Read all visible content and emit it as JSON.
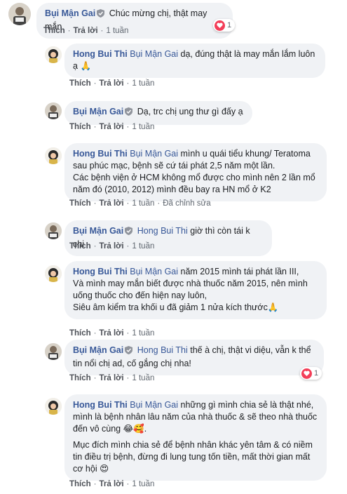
{
  "comments": [
    {
      "author": "Bụi Mận Gai",
      "text": "Chúc mừng chị, thật may mắn",
      "actions": {
        "like": "Thích",
        "reply": "Trả lời",
        "time": "1 tuần"
      },
      "reaction_count": "1"
    },
    {
      "author": "Hong Bui Thi",
      "mention": "Bụi Mận Gai",
      "text": "dạ, đúng thật là may mắn lắm luôn ạ",
      "actions": {
        "like": "Thích",
        "reply": "Trả lời",
        "time": "1 tuần"
      }
    },
    {
      "author": "Bụi Mận Gai",
      "text": "Dạ, trc chị ung thư gì đấy ạ",
      "actions": {
        "like": "Thích",
        "reply": "Trả lời",
        "time": "1 tuần"
      }
    },
    {
      "author": "Hong Bui Thi",
      "mention": "Bụi Mận Gai",
      "line1": "mình u quái tiểu khung/ Teratoma sau phúc mạc, bệnh sẽ cứ tái phát 2,5 năm một lần.",
      "line2": "Các bệnh viện ở HCM không mổ được cho mình nên 2 lần mổ năm đó (2010, 2012) mình đều bay ra HN mổ ở K2",
      "actions": {
        "like": "Thích",
        "reply": "Trả lời",
        "time": "1 tuần",
        "edited": "Đã chỉnh sửa"
      }
    },
    {
      "author": "Bụi Mận Gai",
      "mention": "Hong Bui Thi",
      "text": "giờ thì còn tái k chị",
      "actions": {
        "like": "Thích",
        "reply": "Trả lời",
        "time": "1 tuần"
      }
    },
    {
      "author": "Hong Bui Thi",
      "mention": "Bụi Mận Gai",
      "line1": "năm 2015 mình tái phát lần III,",
      "line2": "Và mình may mắn biết được nhà thuốc năm 2015, nên mình uống thuốc cho đến hiện nay luôn,",
      "line3": "Siêu âm kiểm tra khối u đã giảm 1 nửa kích thước",
      "actions": {
        "like": "Thích",
        "reply": "Trả lời",
        "time": "1 tuần"
      }
    },
    {
      "author": "Bụi Mận Gai",
      "mention": "Hong Bui Thi",
      "text": "thế à chị, thật vi diệu, vẫn k thể tin nổi chị ad, cố gắng chị nha!",
      "actions": {
        "like": "Thích",
        "reply": "Trả lời",
        "time": "1 tuần"
      },
      "reaction_count": "1"
    },
    {
      "author": "Hong Bui Thi",
      "mention": "Bụi Mận Gai",
      "line1": "những gì mình chia sẻ là thật nhé, mình là bệnh nhân lâu năm của nhà thuốc & sẽ theo nhà thuốc đến vô cùng",
      "line2": "Mục đích mình chia sẻ để bệnh nhân khác yên tâm & có niềm tin điều trị bệnh, đừng đi lung tung tốn tiền, mất thời gian mất cơ hội",
      "actions": {
        "like": "Thích",
        "reply": "Trả lời",
        "time": "1 tuần"
      }
    }
  ],
  "colors": {
    "name": "#385898",
    "bubble": "#f0f2f5",
    "heart": "#f33e58",
    "meta": "#606770"
  }
}
